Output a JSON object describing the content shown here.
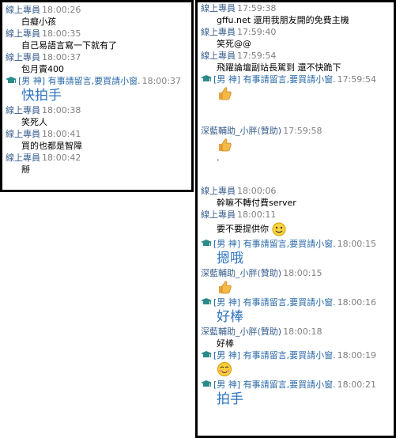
{
  "left_messages": [
    {
      "nick": "線上專員",
      "time": "18:00:26",
      "text": "白癡小孩"
    },
    {
      "nick": "線上專員",
      "time": "18:00:35",
      "text": "自己易語言寫一下就有了"
    },
    {
      "nick": "線上專員",
      "time": "18:00:37",
      "text": "包月賣400"
    },
    {
      "nick": "[男 神] 有事請留言,要買請小窗.",
      "time": "18:00:37",
      "text": "快拍手"
    },
    {
      "nick": "線上專員",
      "time": "18:00:38",
      "text": "笑死人"
    },
    {
      "nick": "線上專員",
      "time": "18:00:41",
      "text": "買的也都是智障"
    },
    {
      "nick": "線上專員",
      "time": "18:00:42",
      "text": "掰"
    }
  ],
  "right_messages": [
    {
      "nick": "線上專員",
      "time": "17:59:38",
      "text": "gffu.net 還用我朋友開的免費主機"
    },
    {
      "nick": "線上專員",
      "time": "17:59:40",
      "text": "笑死@@"
    },
    {
      "nick": "線上專員",
      "time": "17:59:54",
      "text": "飛躍論壇副站長駕到 還不快跪下"
    },
    {
      "nick": "[男 神] 有事請留言,要買請小窗.",
      "time": "17:59:54",
      "emoji": "thumbs-up"
    },
    {
      "nick": "深藍輔助_小胖(贊助)",
      "time": "17:59:58",
      "emoji": "thumbs-up",
      "text": "."
    },
    {
      "nick": "線上專員",
      "time": "18:00:06",
      "text": "幹嘛不轉付費server"
    },
    {
      "nick": "線上專員",
      "time": "18:00:11",
      "text": "要不要提供你",
      "emoji": "smile"
    },
    {
      "nick": "[男 神] 有事請留言,要買請小窗.",
      "time": "18:00:15",
      "text": "摁哦"
    },
    {
      "nick": "深藍輔助_小胖(贊助)",
      "time": "18:00:15",
      "emoji": "thumbs-up"
    },
    {
      "nick": "[男 神] 有事請留言,要買請小窗.",
      "time": "18:00:16",
      "text": "好棒"
    },
    {
      "nick": "深藍輔助_小胖(贊助)",
      "time": "18:00:18",
      "text": "好棒"
    },
    {
      "nick": "[男 神] 有事請留言,要買請小窗.",
      "time": "18:00:19",
      "emoji": "blush"
    },
    {
      "nick": "[男 神] 有事請留言,要買請小窗.",
      "time": "18:00:21",
      "text": "拍手"
    }
  ],
  "colors": {
    "nick": "#3a5f8f",
    "time": "#808080",
    "big_text": "#2f74c0",
    "border": "#000000"
  }
}
